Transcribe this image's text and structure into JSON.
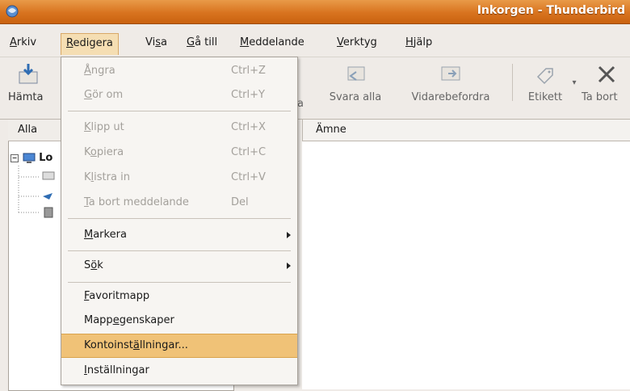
{
  "window": {
    "title": "Inkorgen - Thunderbird"
  },
  "menubar": [
    {
      "label": "Arkiv"
    },
    {
      "label": "Redigera"
    },
    {
      "label": "Visa"
    },
    {
      "label": "Gå till"
    },
    {
      "label": "Meddelande"
    },
    {
      "label": "Verktyg"
    },
    {
      "label": "Hjälp"
    }
  ],
  "toolbar": {
    "get_mail": "Hämta",
    "reply_partial": "a",
    "reply_all": "Svara alla",
    "forward": "Vidarebefordra",
    "tag": "Etikett",
    "delete": "Ta bort"
  },
  "left_header": "Alla",
  "tree_root": "Lo",
  "column_subject": "Ämne",
  "edit_menu": {
    "undo": {
      "label": "Ångra",
      "accel": "Ctrl+Z"
    },
    "redo": {
      "label": "Gör om",
      "accel": "Ctrl+Y"
    },
    "cut": {
      "label": "Klipp ut",
      "accel": "Ctrl+X"
    },
    "copy": {
      "label": "Kopiera",
      "accel": "Ctrl+C"
    },
    "paste": {
      "label": "Klistra in",
      "accel": "Ctrl+V"
    },
    "delete": {
      "label": "Ta bort meddelande",
      "accel": "Del"
    },
    "select": {
      "label": "Markera"
    },
    "find": {
      "label": "Sök"
    },
    "favorite": {
      "label": "Favoritmapp"
    },
    "folder_props": {
      "label": "Mappegenskaper"
    },
    "account_settings": {
      "label": "Kontoinställningar..."
    },
    "preferences": {
      "label": "Inställningar"
    }
  },
  "colors": {
    "titlebar": "#d8731f",
    "highlight": "#f0c277",
    "disabled_text": "#a3a09b"
  }
}
